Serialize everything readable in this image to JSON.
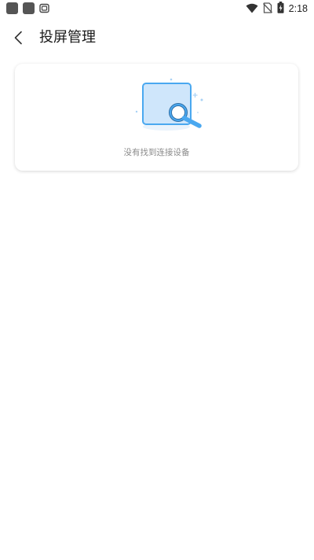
{
  "status_bar": {
    "time": "2:18",
    "left_icons": [
      "app-notification-icon",
      "app-notification-icon",
      "cast-icon"
    ],
    "right_icons": [
      "wifi-icon",
      "no-sim-icon",
      "battery-icon"
    ]
  },
  "header": {
    "back_icon": "chevron-left-icon",
    "title": "投屏管理"
  },
  "device_list": {
    "empty_icon": "search-device-icon",
    "empty_message": "没有找到连接设备"
  },
  "colors": {
    "illustration_blue": "#4aa8f0",
    "illustration_fill": "#cfe6fb",
    "title_text": "#1a1a1a",
    "hint_text": "#8a8a8a"
  }
}
